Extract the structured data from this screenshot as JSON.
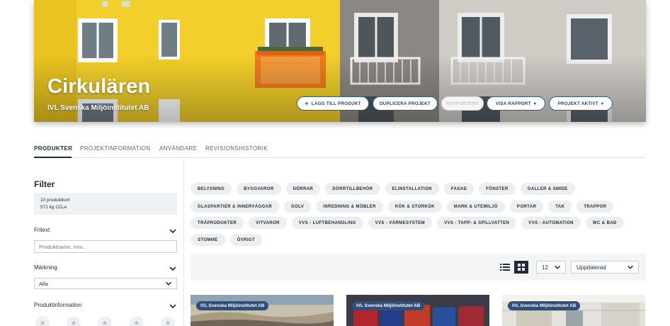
{
  "project": {
    "title": "Cirkulären",
    "organization": "IVL Svenska Miljöinstitutet AB"
  },
  "hero_actions": {
    "add_product": "LÄGG TILL PRODUKT",
    "duplicate_project": "DUPLICERA PROJEKT",
    "report": "RAPPORTERA",
    "show_report": "VISA RAPPORT",
    "project_status": "PROJEKT AKTIVT"
  },
  "tabs": [
    "PRODUKTER",
    "PROJEKTINFORMATION",
    "ANVÄNDARE",
    "REVISIONSHISTORIK"
  ],
  "filter": {
    "title": "Filter",
    "product_count": "10 produktkort",
    "co2": "571 kg CO₂e",
    "freetext_label": "Fritext",
    "freetext_placeholder": "Produktnamn, mm...",
    "marking_label": "Märkning",
    "marking_value": "Alla",
    "product_info_label": "Produktinformation"
  },
  "categories": [
    [
      "BELYSNING",
      "BYGGVAROR",
      "DÖRRAR",
      "DÖRRTILLBEHÖR",
      "ELINSTALLATION",
      "FASAD",
      "FÖNSTER",
      "GALLER & SMIDE"
    ],
    [
      "GLASPARTIER & INNERVÄGGAR",
      "GOLV",
      "INREDNING & MÖBLER",
      "KÖK & STORKÖK",
      "MARK & UTEMILJÖ",
      "PORTAR",
      "TAK",
      "TRAPPOR"
    ],
    [
      "TRÄPRODUKTER",
      "VITVAROR",
      "VVS - LUFTBEHANDLING",
      "VVS - VÄRMESYSTEM",
      "VVS - TAPP- & SPILLVATTEN",
      "VVS - AUTOMATION",
      "WC & BAD"
    ],
    [
      "STOMME",
      "ÖVRIGT"
    ]
  ],
  "toolbar": {
    "per_page": "12",
    "sort": "Uppdaterad"
  },
  "cards": [
    {
      "organization": "IVL Svenska Miljöinstitutet AB"
    },
    {
      "organization": "IVL Svenska Miljöinstitutet AB"
    },
    {
      "organization": "IVL Svenska Miljöinstitutet AB"
    }
  ],
  "colors": {
    "primary": "#1d2b3a",
    "accent": "#2e5b8c",
    "badge": "#2c4f7c",
    "chip_bg": "#eceef0"
  },
  "icons": [
    "plus-icon",
    "chevron-down-icon",
    "list-view-icon",
    "grid-view-icon",
    "star-icon"
  ]
}
